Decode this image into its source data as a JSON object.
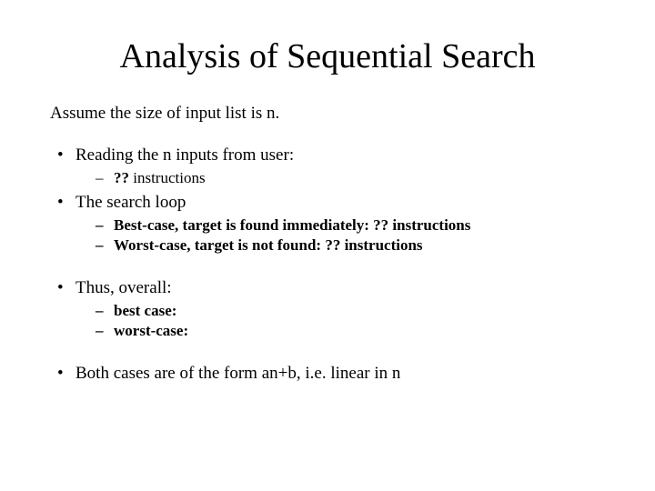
{
  "title": "Analysis of Sequential Search",
  "intro": "Assume the size of input list is n.",
  "b1": {
    "text": "Reading the n inputs from user:",
    "sub1_a": "  ?? ",
    "sub1_b": "instructions"
  },
  "b2": {
    "text": "The search loop",
    "sub1_a": "Best-case, target is found immediately: ",
    "sub1_b": "?? ",
    "sub1_c": " instructions",
    "sub2_a": "Worst-case, target is not found: ",
    "sub2_b": " ?? ",
    "sub2_c": " instructions"
  },
  "b3": {
    "text": "Thus, overall:",
    "sub1": "best case:",
    "sub2": "worst-case:"
  },
  "b4": {
    "a": "Both cases are of the form ",
    "b": "an+b",
    "c": ", i.e. linear in n"
  }
}
